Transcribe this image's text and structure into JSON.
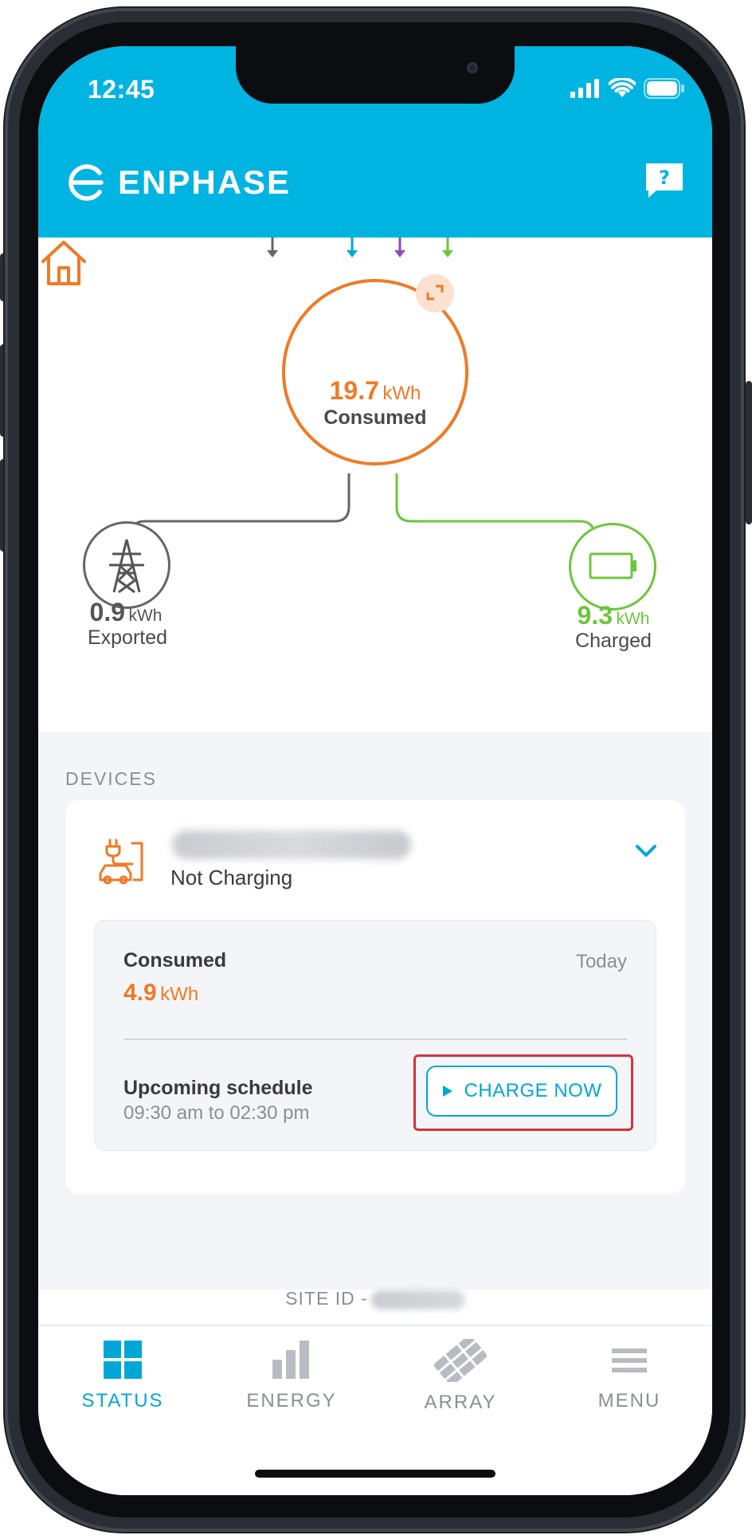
{
  "status_bar": {
    "time": "12:45"
  },
  "header": {
    "brand": "ENPHASE",
    "help_label": "?"
  },
  "flow": {
    "consumed": {
      "value": "19.7",
      "unit": "kWh",
      "label": "Consumed"
    },
    "exported": {
      "value": "0.9",
      "unit": "kWh",
      "label": "Exported"
    },
    "charged": {
      "value": "9.3",
      "unit": "kWh",
      "label": "Charged"
    }
  },
  "devices": {
    "title": "DEVICES",
    "charger": {
      "status": "Not Charging",
      "consumed_label": "Consumed",
      "period": "Today",
      "consumed_value": "4.9",
      "consumed_unit": "kWh",
      "schedule_label": "Upcoming schedule",
      "schedule_time": "09:30 am to 02:30 pm",
      "charge_button": "CHARGE NOW"
    }
  },
  "site": {
    "label": "SITE ID -"
  },
  "nav": [
    {
      "label": "STATUS",
      "icon": "grid-icon",
      "active": true
    },
    {
      "label": "ENERGY",
      "icon": "bar-chart-icon",
      "active": false
    },
    {
      "label": "ARRAY",
      "icon": "solar-array-icon",
      "active": false
    },
    {
      "label": "MENU",
      "icon": "hamburger-icon",
      "active": false
    }
  ],
  "colors": {
    "brand": "#00b4e1",
    "consumed": "#f07a25",
    "charged": "#6cc63a",
    "grid": "#666666",
    "highlight": "#d9313d"
  }
}
